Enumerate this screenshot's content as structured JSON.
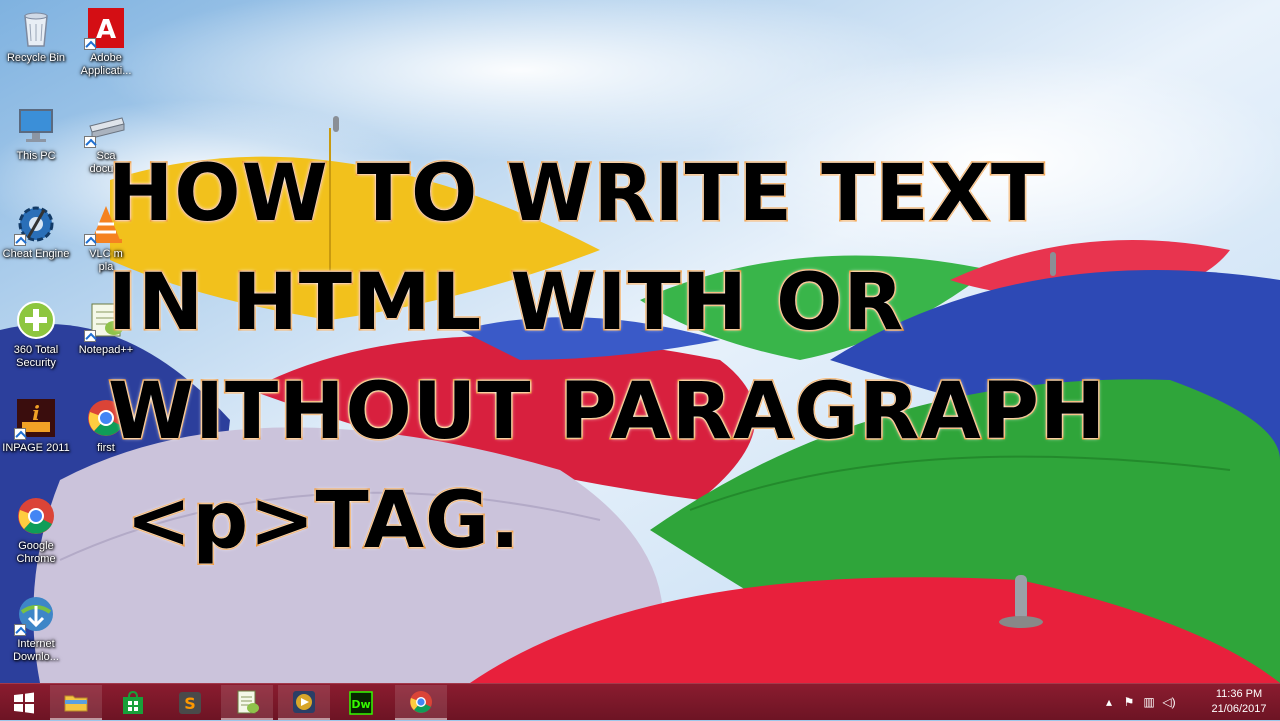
{
  "overlay": {
    "lines": [
      "HOW TO WRITE TEXT",
      "IN HTML WITH OR",
      "WITHOUT PARAGRAPH",
      "<p>TAG."
    ]
  },
  "desktop_icons": [
    {
      "label": "Recycle Bin",
      "icon": "recycle-bin-icon"
    },
    {
      "label": "Adobe\nApplicati...",
      "icon": "adobe-icon"
    },
    {
      "label": "This PC",
      "icon": "this-pc-icon"
    },
    {
      "label": "Sca\ndocum",
      "icon": "scanner-icon"
    },
    {
      "label": "Cheat Engine",
      "icon": "cheat-engine-icon"
    },
    {
      "label": "VLC m\npla",
      "icon": "vlc-icon"
    },
    {
      "label": "360 Total\nSecurity",
      "icon": "security-360-icon"
    },
    {
      "label": "Notepad++",
      "icon": "notepadpp-icon"
    },
    {
      "label": "INPAGE 2011",
      "icon": "inpage-icon"
    },
    {
      "label": "first",
      "icon": "chrome-icon"
    },
    {
      "label": "Google\nChrome",
      "icon": "chrome-icon"
    },
    {
      "label": "Internet\nDownlo...",
      "icon": "idm-icon"
    }
  ],
  "taskbar": {
    "buttons": [
      {
        "name": "start",
        "icon": "windows-icon"
      },
      {
        "name": "file-explorer",
        "icon": "folder-icon"
      },
      {
        "name": "store",
        "icon": "store-icon"
      },
      {
        "name": "sublime",
        "icon": "sublime-icon"
      },
      {
        "name": "notepadpp",
        "icon": "notepadpp-icon"
      },
      {
        "name": "media-player",
        "icon": "media-player-icon"
      },
      {
        "name": "dreamweaver",
        "icon": "dreamweaver-icon",
        "text": "Dw"
      },
      {
        "name": "chrome",
        "icon": "chrome-icon"
      }
    ],
    "clock": {
      "time": "11:36 PM",
      "date": "21/06/2017"
    }
  },
  "colors": {
    "taskbar": "#7a1829",
    "title_fill": "#000000",
    "title_stroke": "#f08a1c"
  }
}
